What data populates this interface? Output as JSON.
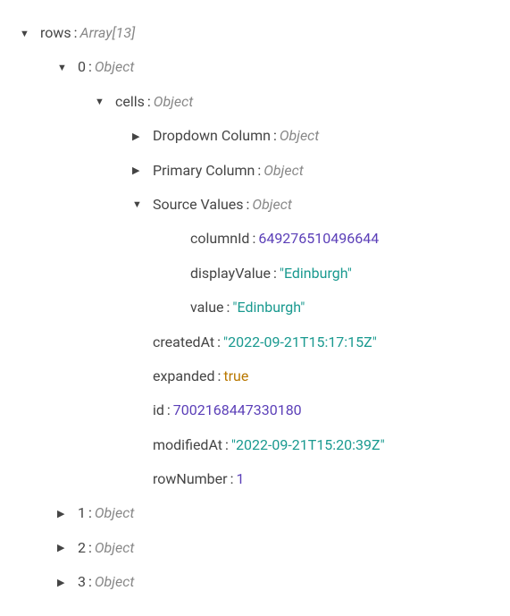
{
  "tree": {
    "root_key": "rows",
    "root_type": "Array[13]",
    "item0_key": "0",
    "item0_type": "Object",
    "cells_key": "cells",
    "cells_type": "Object",
    "dropdown_key": "Dropdown Column",
    "dropdown_type": "Object",
    "primary_key": "Primary Column",
    "primary_type": "Object",
    "source_key": "Source Values",
    "source_type": "Object",
    "columnId_key": "columnId",
    "columnId_val": "649276510496644",
    "displayValue_key": "displayValue",
    "displayValue_val": "\"Edinburgh\"",
    "value_key": "value",
    "value_val": "\"Edinburgh\"",
    "createdAt_key": "createdAt",
    "createdAt_val": "\"2022-09-21T15:17:15Z\"",
    "expanded_key": "expanded",
    "expanded_val": "true",
    "id_key": "id",
    "id_val": "7002168447330180",
    "modifiedAt_key": "modifiedAt",
    "modifiedAt_val": "\"2022-09-21T15:20:39Z\"",
    "rowNumber_key": "rowNumber",
    "rowNumber_val": "1",
    "item1_key": "1",
    "item1_type": "Object",
    "item2_key": "2",
    "item2_type": "Object",
    "item3_key": "3",
    "item3_type": "Object"
  },
  "sep": ": "
}
